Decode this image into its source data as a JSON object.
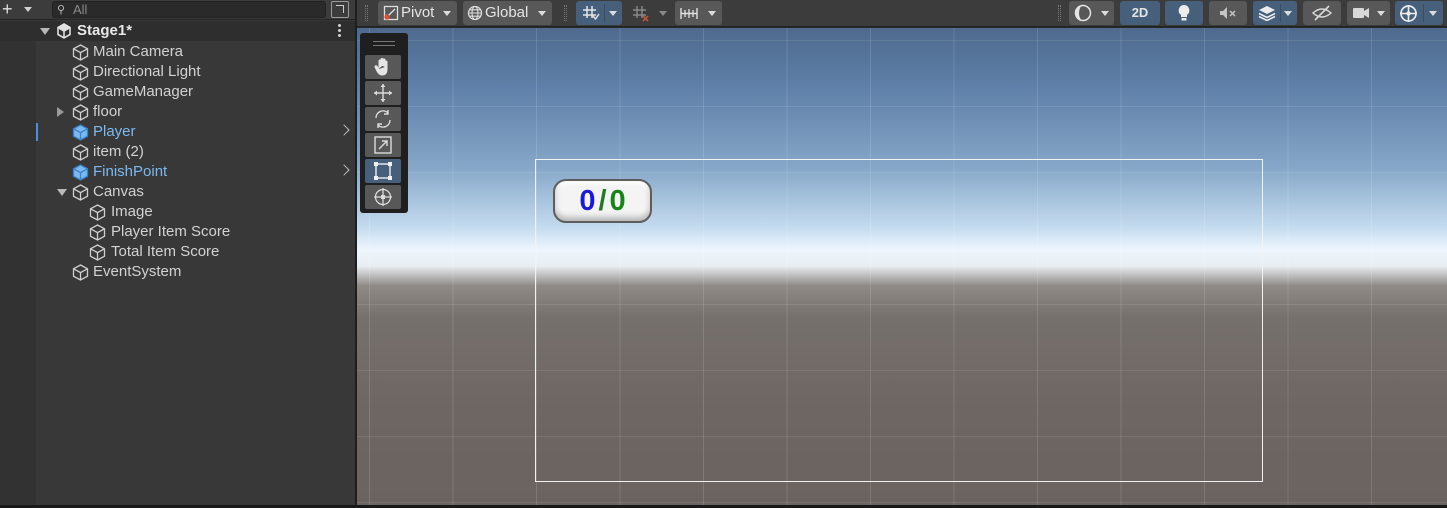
{
  "hierarchy": {
    "search_placeholder": "All",
    "scene_name": "Stage1*",
    "items": [
      {
        "label": "Main Camera",
        "depth": 1,
        "fold": "none",
        "prefab": false
      },
      {
        "label": "Directional Light",
        "depth": 1,
        "fold": "none",
        "prefab": false
      },
      {
        "label": "GameManager",
        "depth": 1,
        "fold": "none",
        "prefab": false
      },
      {
        "label": "floor",
        "depth": 1,
        "fold": "collapsed",
        "prefab": false
      },
      {
        "label": "Player",
        "depth": 1,
        "fold": "none",
        "prefab": true
      },
      {
        "label": "item (2)",
        "depth": 1,
        "fold": "none",
        "prefab": false
      },
      {
        "label": "FinishPoint",
        "depth": 1,
        "fold": "none",
        "prefab": true
      },
      {
        "label": "Canvas",
        "depth": 1,
        "fold": "expanded",
        "prefab": false
      },
      {
        "label": "Image",
        "depth": 2,
        "fold": "none",
        "prefab": false
      },
      {
        "label": "Player Item Score",
        "depth": 2,
        "fold": "none",
        "prefab": false
      },
      {
        "label": "Total Item Score",
        "depth": 2,
        "fold": "none",
        "prefab": false
      },
      {
        "label": "EventSystem",
        "depth": 1,
        "fold": "none",
        "prefab": false
      }
    ],
    "prefab_color": "#7cb9f0"
  },
  "toolbar": {
    "pivot_label": "Pivot",
    "global_label": "Global",
    "mode_2d_label": "2D"
  },
  "game_ui": {
    "player_score": "0",
    "separator": "/",
    "total_score": "0",
    "player_color": "#1a1adc",
    "total_color": "#168416"
  },
  "tools": [
    "hand-tool",
    "move-tool",
    "rotate-tool",
    "scale-tool",
    "rect-tool",
    "transform-tool"
  ],
  "active_tool": "rect-tool",
  "colors": {
    "panel": "#383838",
    "toolbar": "#3c3c3c",
    "button": "#585858",
    "active_button": "#46607c"
  }
}
